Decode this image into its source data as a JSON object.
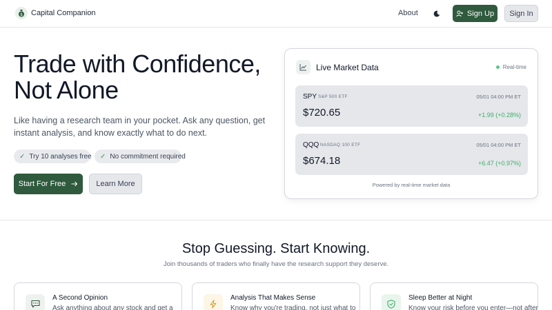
{
  "header": {
    "brand": "Capital Companion",
    "logo_icon": "money-bag-icon",
    "about": "About",
    "theme_icon": "moon-icon",
    "signup": "Sign Up",
    "signin": "Sign In"
  },
  "hero": {
    "title_line1": "Trade with Confidence,",
    "title_line2": "Not Alone",
    "subtitle": "Like having a research team in your pocket. Ask any question, get instant analysis, and know exactly what to do next.",
    "pills": [
      "Try 10 analyses free",
      "No commitment required"
    ],
    "cta_primary": "Start For Free",
    "cta_secondary": "Learn More"
  },
  "market": {
    "title": "Live Market Data",
    "live_label": "Real-time",
    "tickers": [
      {
        "symbol": "SPY",
        "name": "S&P 500 ETF",
        "time": "05/01 04:00 PM ET",
        "price": "$720.65",
        "change": "+1.99 (+0.28%)"
      },
      {
        "symbol": "QQQ",
        "name": "NASDAQ 100 ETF",
        "time": "05/01 04:00 PM ET",
        "price": "$674.18",
        "change": "+6.47 (+0.97%)"
      }
    ],
    "footer": "Powered by real-time market data"
  },
  "section": {
    "title": "Stop Guessing. Start Knowing.",
    "subtitle": "Join thousands of traders who finally have the research support they deserve.",
    "features": [
      {
        "title": "A Second Opinion",
        "desc": "Ask anything about any stock and get a",
        "icon": "chat-icon"
      },
      {
        "title": "Analysis That Makes Sense",
        "desc": "Know why you're trading, not just what to",
        "icon": "lightning-icon"
      },
      {
        "title": "Sleep Better at Night",
        "desc": "Know your risk before you enter—not after",
        "icon": "shield-check-icon"
      }
    ]
  },
  "colors": {
    "primary": "#2f5a3d",
    "positive": "#3fae6a",
    "live": "#5ec28a"
  }
}
